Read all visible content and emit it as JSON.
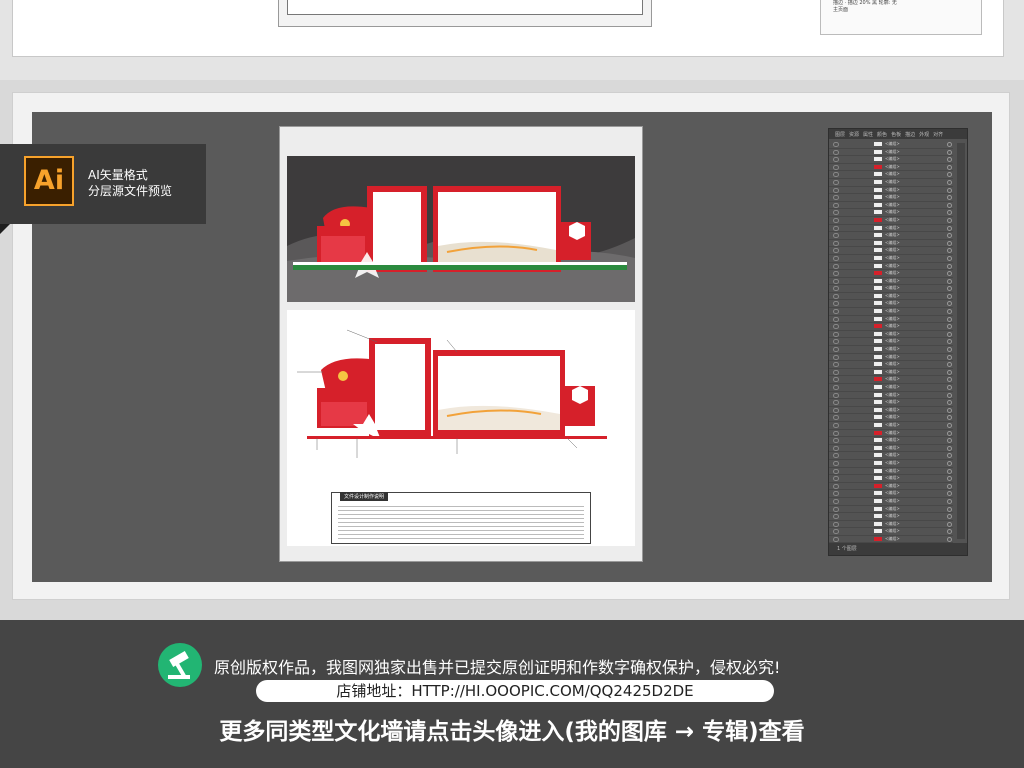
{
  "badge": {
    "logo_text": "Ai",
    "title": "AI矢量格式",
    "subtitle": "分层源文件预览"
  },
  "preview": {
    "explain_title": "文件设计制作说明"
  },
  "top_panel": {
    "lines": [
      "描边 · 描边 20% 黑 轮廓: 无",
      "主页面"
    ]
  },
  "layers_panel": {
    "tabs": [
      "图层",
      "资源",
      "属性",
      "颜色",
      "色板",
      "描边",
      "外观",
      "对齐"
    ],
    "row_label": "<编组>",
    "bottom_label": "1 个图层",
    "row_count": 60
  },
  "footer": {
    "copyright": "原创版权作品，我图网独家出售并已提交原创证明和作数字确权保护，侵权必究!",
    "shop_label": "店铺地址：HTTP://HI.OOOPIC.COM/QQ2425D2DE",
    "more_text": "更多同类型文化墙请点击头像进入(我的图库 → 专辑)查看"
  },
  "colors": {
    "accent_red": "#d6202a",
    "ai_orange": "#f7a22b",
    "brand_green": "#22b573"
  }
}
